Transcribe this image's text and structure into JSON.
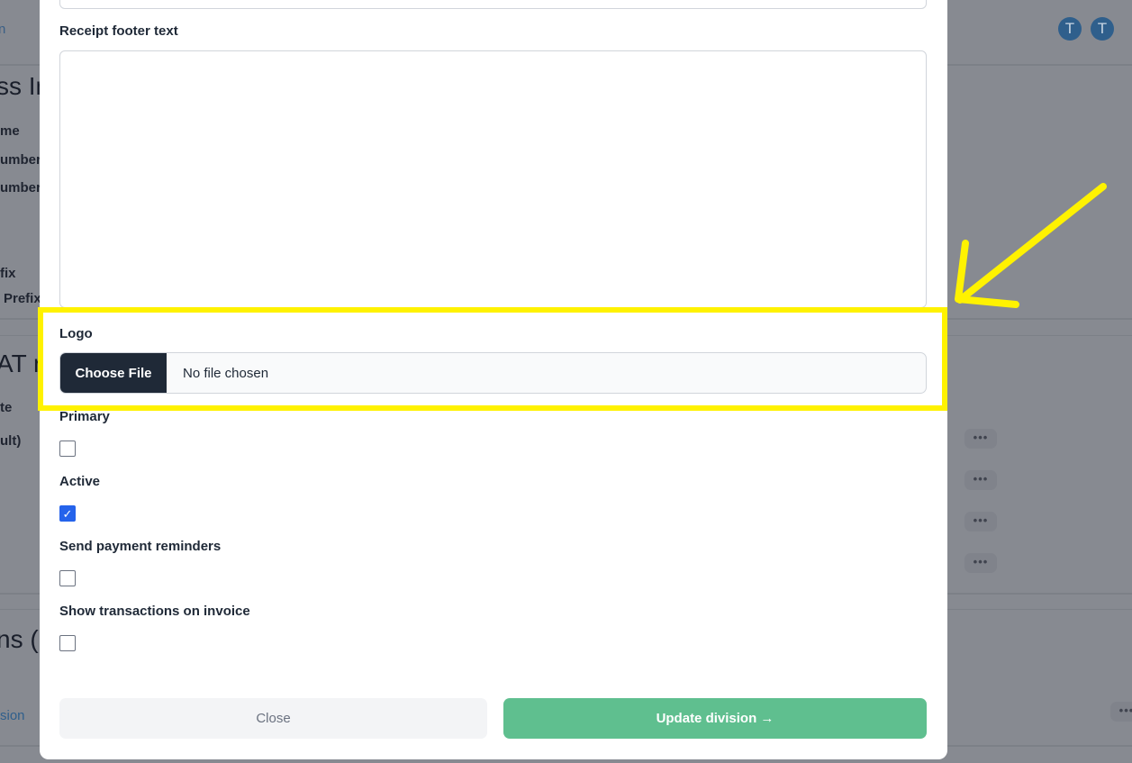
{
  "background": {
    "fragments": [
      "n",
      "ss In",
      "me",
      "umber",
      "umber",
      "fix",
      "Prefix",
      "AT ra",
      "te",
      "ult)",
      "ns (",
      "sion"
    ],
    "avatars": [
      "T",
      "T"
    ],
    "more_label": "•••"
  },
  "modal": {
    "receipt_footer_label": "Receipt footer text",
    "receipt_footer_value": "",
    "logo_label": "Logo",
    "choose_file_label": "Choose File",
    "no_file_label": "No file chosen",
    "primary_label": "Primary",
    "primary_checked": false,
    "active_label": "Active",
    "active_checked": true,
    "reminders_label": "Send payment reminders",
    "reminders_checked": false,
    "transactions_label": "Show transactions on invoice",
    "transactions_checked": false,
    "close_label": "Close",
    "update_label": "Update division →",
    "update_color": "#5fbf8f"
  },
  "annotation": {
    "color": "#fff200"
  }
}
